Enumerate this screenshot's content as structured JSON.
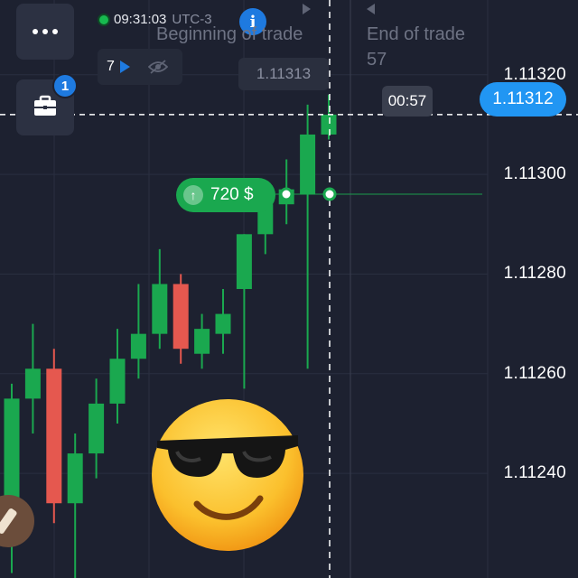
{
  "chart_data": {
    "type": "candlestick",
    "y_ticks": [
      "1.11320",
      "1.11300",
      "1.11280",
      "1.11260",
      "1.11240"
    ],
    "y_tick_values": [
      1.1132,
      1.113,
      1.1128,
      1.1126,
      1.1124
    ],
    "ylim": [
      1.11219,
      1.11335
    ],
    "current_price": 1.11312,
    "entry_price": 1.11296,
    "candles": [
      {
        "open": 1.11235,
        "high": 1.11258,
        "low": 1.1122,
        "close": 1.11255
      },
      {
        "open": 1.11255,
        "high": 1.1127,
        "low": 1.11248,
        "close": 1.11261
      },
      {
        "open": 1.11261,
        "high": 1.11265,
        "low": 1.1123,
        "close": 1.11234
      },
      {
        "open": 1.11234,
        "high": 1.11248,
        "low": 1.11216,
        "close": 1.11244
      },
      {
        "open": 1.11244,
        "high": 1.11259,
        "low": 1.11239,
        "close": 1.11254
      },
      {
        "open": 1.11254,
        "high": 1.11269,
        "low": 1.1125,
        "close": 1.11263
      },
      {
        "open": 1.11263,
        "high": 1.11278,
        "low": 1.11259,
        "close": 1.11268
      },
      {
        "open": 1.11268,
        "high": 1.11285,
        "low": 1.11265,
        "close": 1.11278
      },
      {
        "open": 1.11278,
        "high": 1.1128,
        "low": 1.11262,
        "close": 1.11265
      },
      {
        "open": 1.11264,
        "high": 1.11272,
        "low": 1.11261,
        "close": 1.11269
      },
      {
        "open": 1.11268,
        "high": 1.11277,
        "low": 1.11264,
        "close": 1.11272
      },
      {
        "open": 1.11277,
        "high": 1.11288,
        "low": 1.11257,
        "close": 1.11288
      },
      {
        "open": 1.11288,
        "high": 1.11298,
        "low": 1.11284,
        "close": 1.11294
      },
      {
        "open": 1.11294,
        "high": 1.11303,
        "low": 1.1129,
        "close": 1.11297
      },
      {
        "open": 1.11296,
        "high": 1.11314,
        "low": 1.11261,
        "close": 1.11308
      },
      {
        "open": 1.11308,
        "high": 1.11316,
        "low": 1.11307,
        "close": 1.11312
      }
    ],
    "up_color": "#1aa84f",
    "down_color": "#e5584f",
    "background": "#1d2130"
  },
  "header": {
    "time": "09:31:03",
    "timezone": "UTC-3",
    "begin_label": "Beginning of trade",
    "end_label": "End of trade",
    "end_count": "57"
  },
  "toolbar": {
    "count": "7",
    "ghost_price": "1.11313"
  },
  "timer": "00:57",
  "current_price_label": "1.11312",
  "trade": {
    "amount_label": "720 $",
    "direction": "up"
  },
  "portfolio_badge": "1",
  "icons": {
    "menu": "more-dots-icon",
    "portfolio": "briefcase-icon",
    "info": "info-icon",
    "play": "play-icon",
    "hide": "eye-off-icon",
    "emoji": "sunglasses-emoji-icon"
  },
  "colors": {
    "accent": "#1e7ae0",
    "price_tag": "#2196f3",
    "up": "#1aa84f",
    "down": "#e5584f"
  }
}
